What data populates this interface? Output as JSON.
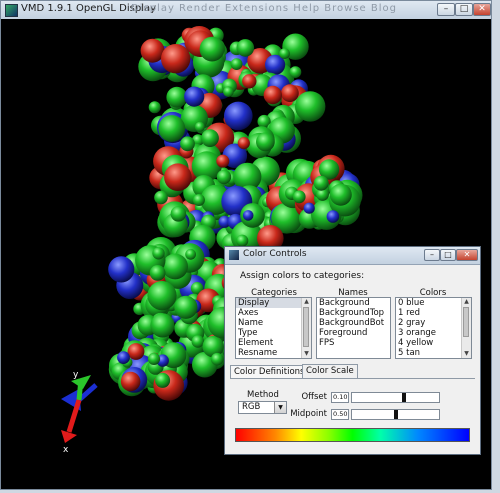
{
  "window": {
    "title": "VMD 1.9.1 OpenGL Display",
    "background_behind_title": "Display   Render   Extensions   Help            Browse   Blog"
  },
  "axes": {
    "x_label": "x",
    "y_label": "y",
    "x_color": "#e21b1b",
    "y_color": "#2bc52b",
    "z_color": "#1b2fd2"
  },
  "dialog": {
    "title": "Color Controls",
    "prompt": "Assign colors to categories:",
    "columns": {
      "categories": "Categories",
      "names": "Names",
      "colors": "Colors"
    },
    "categories": [
      "Display",
      "Axes",
      "Name",
      "Type",
      "Element",
      "Resname"
    ],
    "selected_category": "Display",
    "names": [
      "Background",
      "BackgroundTop",
      "BackgroundBot",
      "Foreground",
      "FPS"
    ],
    "colors": [
      "0 blue",
      "1 red",
      "2 gray",
      "3 orange",
      "4 yellow",
      "5 tan"
    ],
    "tabs": [
      "Color Definitions",
      "Color Scale"
    ],
    "active_tab": "Color Scale",
    "method_label": "Method",
    "method_value": "RGB",
    "offset_label": "Offset",
    "offset_value": "0.10",
    "offset_fraction": 0.6,
    "midpoint_label": "Midpoint",
    "midpoint_value": "0.50",
    "midpoint_fraction": 0.5
  }
}
